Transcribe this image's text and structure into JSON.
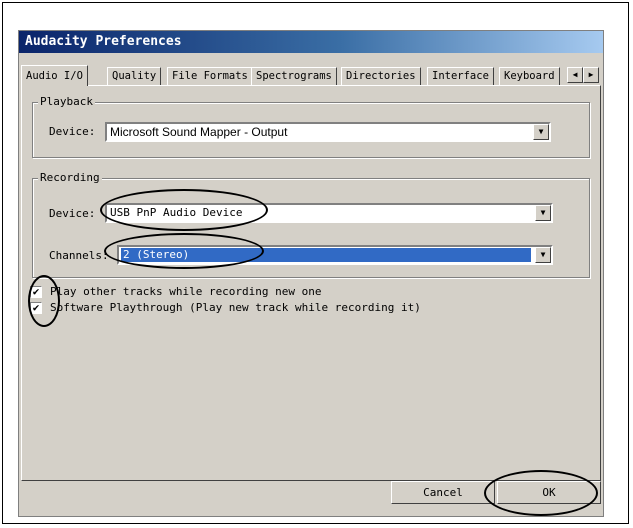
{
  "dialog": {
    "title": "Audacity Preferences",
    "tabs": [
      {
        "label": "Audio I/O",
        "active": true
      },
      {
        "label": "Quality"
      },
      {
        "label": "File Formats"
      },
      {
        "label": "Spectrograms"
      },
      {
        "label": "Directories"
      },
      {
        "label": "Interface"
      },
      {
        "label": "Keyboard"
      }
    ],
    "tab_scroll": {
      "left": "◀",
      "right": "▶"
    },
    "playback": {
      "title": "Playback",
      "device_label": "Device:",
      "device_value": "Microsoft Sound Mapper - Output"
    },
    "recording": {
      "title": "Recording",
      "device_label": "Device:",
      "device_value": "USB PnP Audio Device",
      "channels_label": "Channels:",
      "channels_value": "2 (Stereo)"
    },
    "options": [
      {
        "label": "Play other tracks while recording new one",
        "checked": true
      },
      {
        "label": "Software Playthrough (Play new track while recording it)",
        "checked": true
      }
    ],
    "buttons": {
      "cancel": "Cancel",
      "ok": "OK"
    },
    "combo_arrow": "▼",
    "check_mark": "✔"
  }
}
